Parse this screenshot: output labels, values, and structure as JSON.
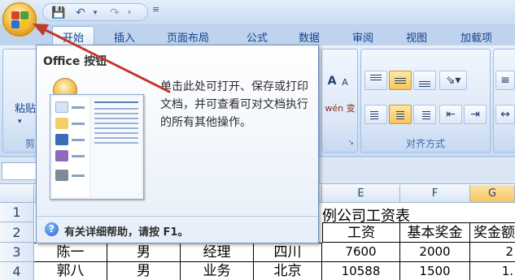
{
  "ribbon": {
    "tabs": [
      "开始",
      "插入",
      "页面布局",
      "公式",
      "数据",
      "审阅",
      "视图",
      "加载项"
    ],
    "active_tab": "开始",
    "paste_label": "粘贴",
    "font_size_buttons": [
      "A",
      "A"
    ],
    "alignment_group_label": "对齐方式",
    "wen_button": "wén 变"
  },
  "tooltip": {
    "title": "Office 按钮",
    "description": "单击此处可打开、保存或打印文档，并可查看可对文档执行的所有其他操作。",
    "help": "有关详细帮助，请按 F1。",
    "help_icon": "question-icon"
  },
  "sheet": {
    "columns": [
      "E",
      "F",
      "G"
    ],
    "rows": [
      "1",
      "2",
      "3",
      "4"
    ],
    "title_text": "例公司工资表",
    "headers": [
      "工资",
      "基本奖金",
      "奖金额"
    ],
    "data": [
      [
        "陈一",
        "男",
        "经理",
        "四川",
        "7600",
        "2000",
        "2"
      ],
      [
        "郭八",
        "男",
        "业务",
        "北京",
        "10588",
        "1500",
        "1."
      ]
    ]
  },
  "colors": {
    "accent": "#15428b",
    "arrow": "#c0392b",
    "selected_header": "#f6c565"
  }
}
